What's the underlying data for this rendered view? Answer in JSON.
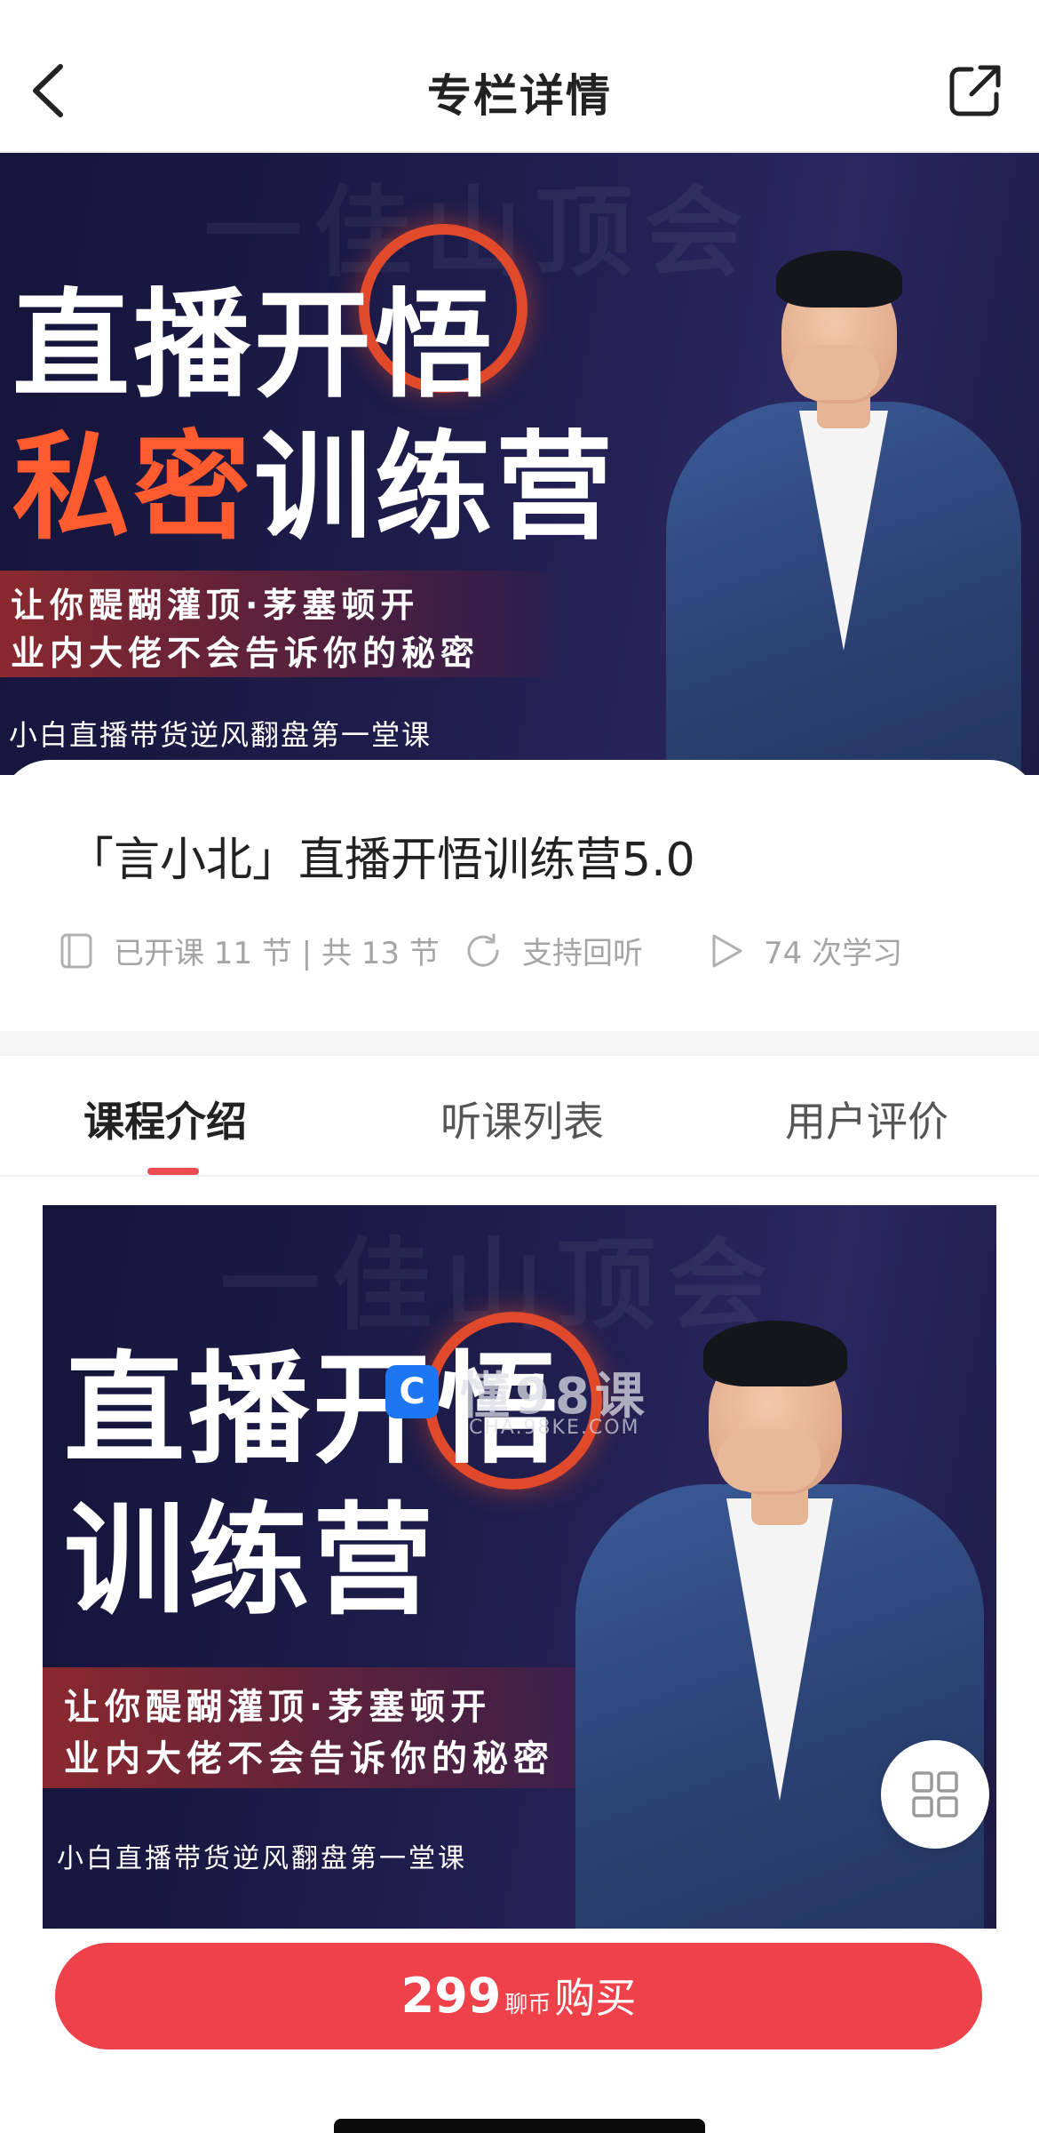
{
  "navbar": {
    "title": "专栏详情",
    "back_icon": "chevron-left-icon",
    "share_icon": "share-external-icon"
  },
  "banner": {
    "ghost_text": "一佳山顶会",
    "title_line1": "直播开悟",
    "title_line2_accent": "私密",
    "title_line2_rest": "训练营",
    "slogan_line1": "让你醍醐灌顶·茅塞顿开",
    "slogan_line2": "业内大佬不会告诉你的秘密",
    "tagline": "小白直播带货逆风翻盘第一堂课"
  },
  "course": {
    "title": "「言小北」直播开悟训练营5.0",
    "lessons": "已开课 11 节 | 共 13 节",
    "replay": "支持回听",
    "study_count": "74 次学习"
  },
  "tabs": [
    {
      "label": "课程介绍",
      "active": true
    },
    {
      "label": "听课列表",
      "active": false
    },
    {
      "label": "用户评价",
      "active": false
    }
  ],
  "poster": {
    "ghost_text": "一佳山顶会",
    "title_line1": "直播开悟",
    "title_line2": "训练营",
    "slogan_line1": "让你醍醐灌顶·茅塞顿开",
    "slogan_line2": "业内大佬不会告诉你的秘密",
    "tagline": "小白直播带货逆风翻盘第一堂课",
    "watermark_text": "懂98课",
    "watermark_sub": "CHA.98KE.COM"
  },
  "buy": {
    "price": "299",
    "unit": "聊币",
    "label": "购买"
  },
  "colors": {
    "accent_red": "#ef4149",
    "tab_indicator": "#ee4a52",
    "banner_orange": "#ff5b2e",
    "banner_bg": "#1f1d4c"
  }
}
